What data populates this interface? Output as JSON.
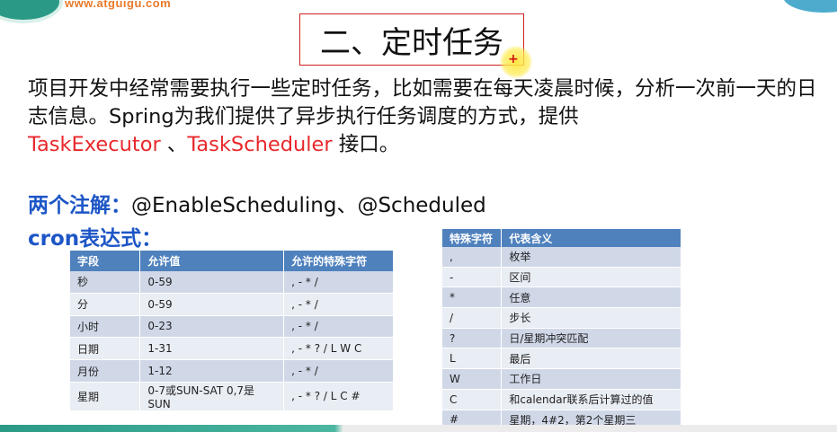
{
  "header": {
    "site_url": "www.atguigu.com"
  },
  "title": "二、定时任务",
  "paragraph": {
    "part1": "项目开发中经常需要执行一些定时任务，比如需要在每天凌晨时候，分析一次前一天的日志信息。Spring为我们提供了异步执行任务调度的方式，提供",
    "executor": "TaskExecutor",
    "sep": " 、",
    "scheduler": "TaskScheduler",
    "part2": " 接口。"
  },
  "annotations": {
    "label": "两个注解：",
    "value": "@EnableScheduling、@Scheduled"
  },
  "cron_title": "cron表达式：",
  "fields_table": {
    "headers": [
      "字段",
      "允许值",
      "允许的特殊字符"
    ],
    "rows": [
      [
        "秒",
        "0-59",
        ", - * /"
      ],
      [
        "分",
        "0-59",
        ", - * /"
      ],
      [
        "小时",
        "0-23",
        ", - * /"
      ],
      [
        "日期",
        "1-31",
        ", - * ? / L W C"
      ],
      [
        "月份",
        "1-12",
        ", - * /"
      ],
      [
        "星期",
        "0-7或SUN-SAT 0,7是SUN",
        ", - * ? / L C #"
      ]
    ]
  },
  "special_table": {
    "headers": [
      "特殊字符",
      "代表含义"
    ],
    "rows": [
      [
        ",",
        "枚举"
      ],
      [
        "-",
        "区间"
      ],
      [
        "*",
        "任意"
      ],
      [
        "/",
        "步长"
      ],
      [
        "?",
        "日/星期冲突匹配"
      ],
      [
        "L",
        "最后"
      ],
      [
        "W",
        "工作日"
      ],
      [
        "C",
        "和calendar联系后计算过的值"
      ],
      [
        "#",
        "星期，4#2，第2个星期三"
      ]
    ]
  },
  "colors": {
    "table_header": "#4f81bd",
    "row_odd": "#d0d8e8",
    "row_even": "#e9edf4",
    "highlight_red": "#e8282c",
    "highlight_blue": "#1d56c6",
    "title_border": "#d02020"
  }
}
